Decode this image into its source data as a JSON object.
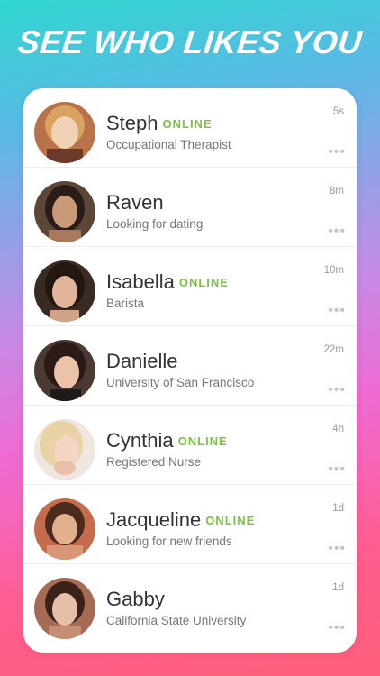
{
  "headline": "SEE WHO LIKES YOU",
  "colors": {
    "online": "#7cc243",
    "bg_top": "#2fd6cf",
    "bg_bottom": "#ff5f7a"
  },
  "people": [
    {
      "name": "Steph",
      "status": "ONLINE",
      "subtitle": "Occupational Therapist",
      "time": "5s",
      "more": "•••",
      "avatar": "avatar-photo"
    },
    {
      "name": "Raven",
      "status": "",
      "subtitle": "Looking for dating",
      "time": "8m",
      "more": "•••",
      "avatar": "avatar-photo"
    },
    {
      "name": "Isabella",
      "status": "ONLINE",
      "subtitle": "Barista",
      "time": "10m",
      "more": "•••",
      "avatar": "avatar-photo"
    },
    {
      "name": "Danielle",
      "status": "",
      "subtitle": "University of San Francisco",
      "time": "22m",
      "more": "•••",
      "avatar": "avatar-photo"
    },
    {
      "name": "Cynthia",
      "status": "ONLINE",
      "subtitle": "Registered Nurse",
      "time": "4h",
      "more": "•••",
      "avatar": "avatar-photo"
    },
    {
      "name": "Jacqueline",
      "status": "ONLINE",
      "subtitle": "Looking for new friends",
      "time": "1d",
      "more": "•••",
      "avatar": "avatar-photo"
    },
    {
      "name": "Gabby",
      "status": "",
      "subtitle": "California State University",
      "time": "1d",
      "more": "•••",
      "avatar": "avatar-photo"
    }
  ]
}
